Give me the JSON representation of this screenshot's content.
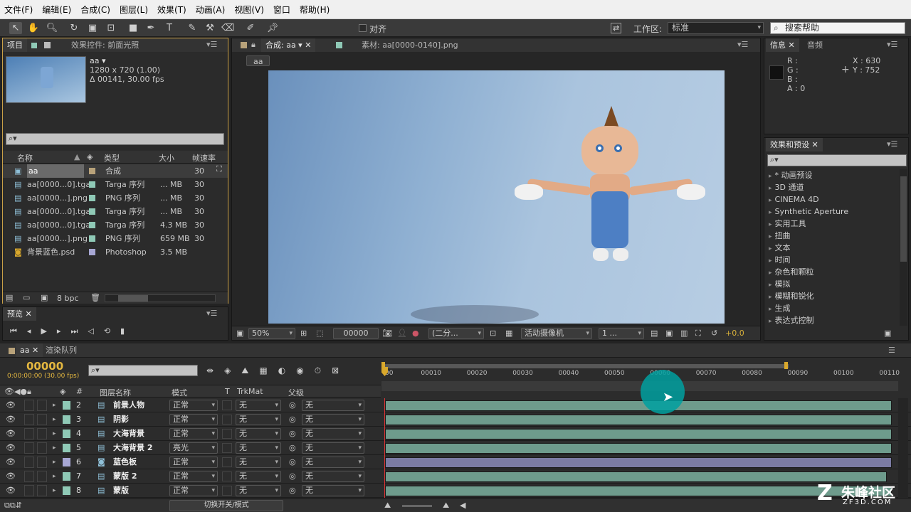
{
  "menu": [
    "文件(F)",
    "编辑(E)",
    "合成(C)",
    "图层(L)",
    "效果(T)",
    "动画(A)",
    "视图(V)",
    "窗口",
    "帮助(H)"
  ],
  "toolbar": {
    "snap_label": "对齐",
    "workspace_label": "工作区:",
    "workspace_value": "标准",
    "search_help": "搜索帮助"
  },
  "project": {
    "tabs": [
      "项目",
      "效果控件: 前面光照"
    ],
    "comp_name": "aa ▾",
    "comp_size": "1280 x 720 (1.00)",
    "comp_duration": "Δ 00141, 30.00 fps",
    "columns": [
      "名称",
      "类型",
      "大小",
      "帧速率"
    ],
    "items": [
      {
        "name": "aa",
        "type": "合成",
        "size": "",
        "fps": "30",
        "color": "#b8a27a"
      },
      {
        "name": "aa[0000...0].tga",
        "type": "Targa 序列",
        "size": "... MB",
        "fps": "30",
        "color": "#8fc9b6"
      },
      {
        "name": "aa[0000...].png",
        "type": "PNG 序列",
        "size": "... MB",
        "fps": "30",
        "color": "#8fc9b6"
      },
      {
        "name": "aa[0000...0].tga",
        "type": "Targa 序列",
        "size": "... MB",
        "fps": "30",
        "color": "#8fc9b6"
      },
      {
        "name": "aa[0000...0].tga",
        "type": "Targa 序列",
        "size": "4.3 MB",
        "fps": "30",
        "color": "#8fc9b6"
      },
      {
        "name": "aa[0000...].png",
        "type": "PNG 序列",
        "size": "659 MB",
        "fps": "30",
        "color": "#8fc9b6"
      },
      {
        "name": "背景蓝色.psd",
        "type": "Photoshop",
        "size": "3.5 MB",
        "fps": "",
        "color": "#a7a7d4"
      }
    ],
    "bpc": "8 bpc"
  },
  "preview": {
    "tab": "预览"
  },
  "viewer": {
    "comp_tab": "合成: aa",
    "footage_tab": "素材: aa[0000-0140].png",
    "breadcrumb": "aa",
    "zoom": "50%",
    "timecode": "00000",
    "resolution": "(二分...",
    "camera": "活动摄像机",
    "views": "1 ...",
    "exposure": "+0.0"
  },
  "info": {
    "tabs": [
      "信息",
      "音频"
    ],
    "r": "R :",
    "g": "G :",
    "b": "B :",
    "a": "A : 0",
    "x": "X : 630",
    "y": "Y : 752"
  },
  "effects": {
    "tab": "效果和预设",
    "items": [
      "* 动画预设",
      "3D 通道",
      "CINEMA 4D",
      "Synthetic Aperture",
      "实用工具",
      "扭曲",
      "文本",
      "时间",
      "杂色和颗粒",
      "模拟",
      "模糊和锐化",
      "生成",
      "表达式控制"
    ]
  },
  "timeline": {
    "tabs": [
      "aa",
      "渲染队列"
    ],
    "timecode": "00000",
    "timecode_sub": "0:00:00:00 (30.00 fps)",
    "col_headers": {
      "name": "图层名称",
      "mode": "模式",
      "t": "T",
      "trkmat": "TrkMat",
      "parent": "父级",
      "num": "#"
    },
    "ruler": [
      "00010",
      "00020",
      "00030",
      "00040",
      "00050",
      "00060",
      "00070",
      "00080",
      "00090",
      "00100",
      "00110"
    ],
    "ruler_start": "00",
    "layers": [
      {
        "num": "2",
        "name": "前景人物",
        "mode": "正常",
        "trk": "无",
        "parent": "无",
        "color": "#8fc9b6",
        "bar": "#6e9b8c"
      },
      {
        "num": "3",
        "name": "阴影",
        "mode": "正常",
        "trk": "无",
        "parent": "无",
        "color": "#8fc9b6",
        "bar": "#6e9b8c"
      },
      {
        "num": "4",
        "name": "大海背景",
        "mode": "正常",
        "trk": "无",
        "parent": "无",
        "color": "#8fc9b6",
        "bar": "#6e9b8c"
      },
      {
        "num": "5",
        "name": "大海背景 2",
        "mode": "亮光",
        "trk": "无",
        "parent": "无",
        "color": "#8fc9b6",
        "bar": "#6e9b8c"
      },
      {
        "num": "6",
        "name": "蓝色板",
        "mode": "正常",
        "trk": "无",
        "parent": "无",
        "color": "#a7a7d4",
        "bar": "#7b7ba3"
      },
      {
        "num": "7",
        "name": "蒙版 2",
        "mode": "正常",
        "trk": "无",
        "parent": "无",
        "color": "#8fc9b6",
        "bar": "#6e9b8c"
      },
      {
        "num": "8",
        "name": "蒙版",
        "mode": "正常",
        "trk": "无",
        "parent": "无",
        "color": "#8fc9b6",
        "bar": "#6e9b8c"
      }
    ],
    "switch_label": "切换开关/模式"
  },
  "watermark": {
    "text": "朱峰社区",
    "sub": "ZF3D.COM"
  }
}
